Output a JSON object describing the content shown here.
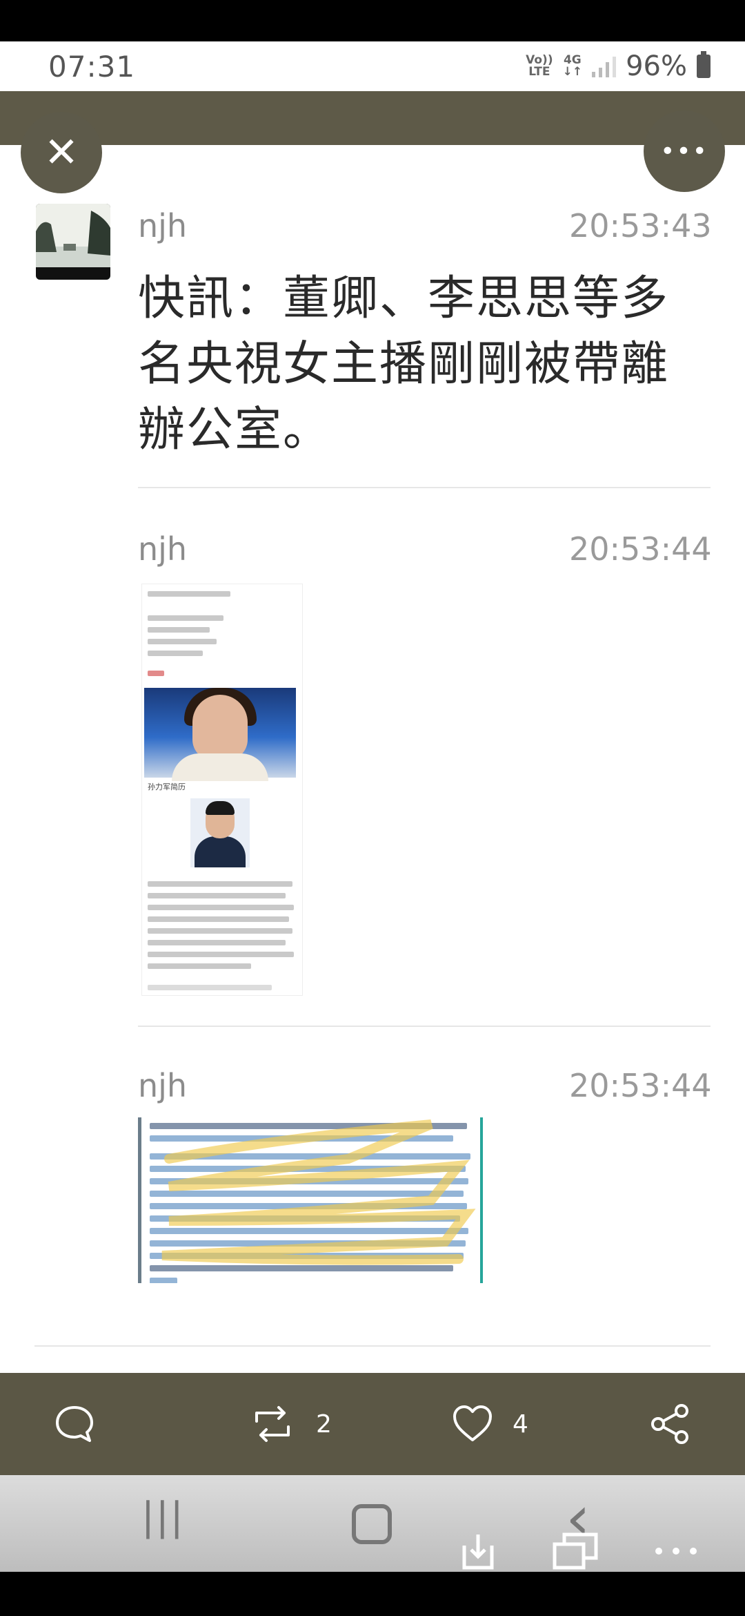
{
  "status_bar": {
    "time": "07:31",
    "volte_top": "Vo))",
    "volte_bottom": "LTE",
    "network_top": "4G",
    "network_bottom": "↓↑",
    "battery": "96%"
  },
  "header": {
    "close_icon": "close-icon",
    "more_icon": "more-icon",
    "more_glyph": "•••",
    "close_glyph": "✕"
  },
  "posts": [
    {
      "username": "njh",
      "time": "20:53:43",
      "text": "快訊：董卿、李思思等多名央視女主播剛剛被帶離辦公室。"
    },
    {
      "username": "njh",
      "time": "20:53:44",
      "image": "article-screenshot",
      "caption": "孙力军简历"
    },
    {
      "username": "njh",
      "time": "20:53:44",
      "image": "highlighted-document-screenshot"
    }
  ],
  "actions": {
    "reply_icon": "comment-icon",
    "repost_icon": "repost-icon",
    "repost_count": "2",
    "like_icon": "heart-icon",
    "like_count": "4",
    "share_icon": "share-icon"
  },
  "nav": {
    "recent_glyph": "|||",
    "home_glyph": "◯",
    "back_glyph": "‹"
  },
  "colors": {
    "header_bg": "#5e5a48",
    "action_bar_bg": "#5b5745",
    "highlight": "#f0c94d"
  }
}
